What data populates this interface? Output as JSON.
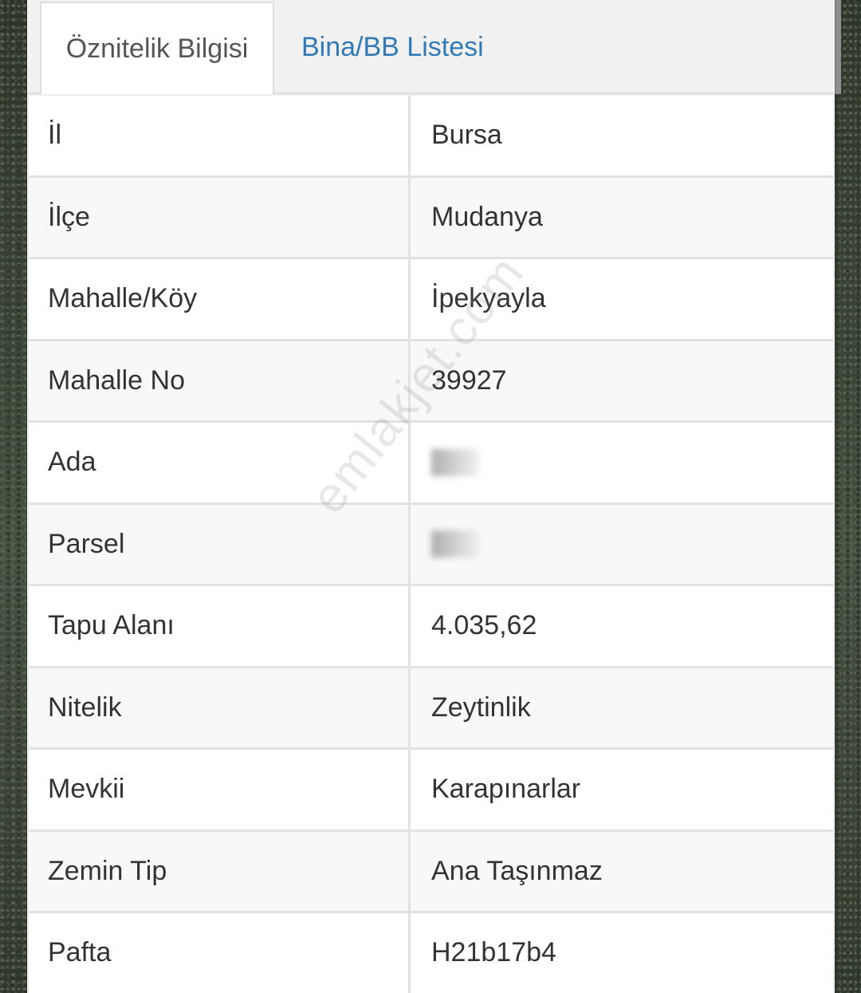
{
  "tabs": [
    {
      "label": "Öznitelik Bilgisi",
      "active": true
    },
    {
      "label": "Bina/BB Listesi",
      "active": false
    }
  ],
  "rows": [
    {
      "label": "İl",
      "value": "Bursa"
    },
    {
      "label": "İlçe",
      "value": "Mudanya"
    },
    {
      "label": "Mahalle/Köy",
      "value": "İpekyayla"
    },
    {
      "label": "Mahalle No",
      "value": "39927"
    },
    {
      "label": "Ada",
      "value": ""
    },
    {
      "label": "Parsel",
      "value": ""
    },
    {
      "label": "Tapu Alanı",
      "value": "4.035,62"
    },
    {
      "label": "Nitelik",
      "value": "Zeytinlik"
    },
    {
      "label": "Mevkii",
      "value": "Karapınarlar"
    },
    {
      "label": "Zemin Tip",
      "value": "Ana Taşınmaz"
    },
    {
      "label": "Pafta",
      "value": "H21b17b4"
    }
  ],
  "watermark": "emlakjet.com",
  "colors": {
    "active_tab_text": "#555555",
    "inactive_tab_text": "#337ab7",
    "cell_text": "#333333",
    "border": "#e2e2e2"
  }
}
